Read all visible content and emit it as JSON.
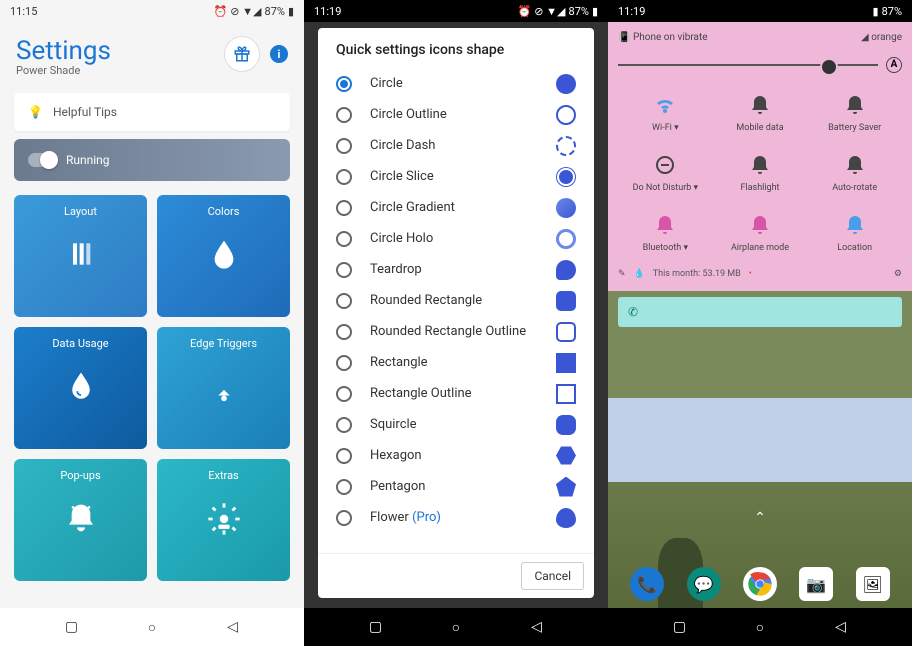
{
  "status": {
    "time1": "11:15",
    "time2": "11:19",
    "time3": "11:19",
    "battery": "87%",
    "icons": "⏰ ⊘ ▼◢"
  },
  "s1": {
    "title": "Settings",
    "subtitle": "Power Shade",
    "tips": "Helpful Tips",
    "running": "Running",
    "tiles": [
      {
        "label": "Layout",
        "icon": "layout"
      },
      {
        "label": "Colors",
        "icon": "colors"
      },
      {
        "label": "Data Usage",
        "icon": "data"
      },
      {
        "label": "Edge Triggers",
        "icon": "edge"
      },
      {
        "label": "Pop-ups",
        "icon": "popups"
      },
      {
        "label": "Extras",
        "icon": "extras"
      }
    ]
  },
  "s2": {
    "title": "Quick settings icons shape",
    "cancel": "Cancel",
    "options": [
      {
        "label": "Circle",
        "selected": true,
        "shape": "circle"
      },
      {
        "label": "Circle Outline",
        "selected": false,
        "shape": "co"
      },
      {
        "label": "Circle Dash",
        "selected": false,
        "shape": "cd"
      },
      {
        "label": "Circle Slice",
        "selected": false,
        "shape": "cs"
      },
      {
        "label": "Circle Gradient",
        "selected": false,
        "shape": "cg"
      },
      {
        "label": "Circle Holo",
        "selected": false,
        "shape": "ch"
      },
      {
        "label": "Teardrop",
        "selected": false,
        "shape": "td"
      },
      {
        "label": "Rounded Rectangle",
        "selected": false,
        "shape": "rr"
      },
      {
        "label": "Rounded Rectangle Outline",
        "selected": false,
        "shape": "rro"
      },
      {
        "label": "Rectangle",
        "selected": false,
        "shape": "r"
      },
      {
        "label": "Rectangle Outline",
        "selected": false,
        "shape": "ro"
      },
      {
        "label": "Squircle",
        "selected": false,
        "shape": "sq"
      },
      {
        "label": "Hexagon",
        "selected": false,
        "shape": "hex"
      },
      {
        "label": "Pentagon",
        "selected": false,
        "shape": "pent"
      },
      {
        "label": "Flower",
        "pro": "(Pro)",
        "selected": false,
        "shape": "fl"
      }
    ]
  },
  "s3": {
    "vibrate": "Phone on vibrate",
    "carrier": "orange",
    "auto": "A",
    "tiles": [
      {
        "label": "Wi-Fi ▾",
        "shape": "wifi",
        "cls": "active"
      },
      {
        "label": "Mobile data",
        "shape": "bell",
        "cls": ""
      },
      {
        "label": "Battery Saver",
        "shape": "bell",
        "cls": ""
      },
      {
        "label": "Do Not Disturb ▾",
        "shape": "dnd",
        "cls": ""
      },
      {
        "label": "Flashlight",
        "shape": "bell",
        "cls": ""
      },
      {
        "label": "Auto-rotate",
        "shape": "bell",
        "cls": ""
      },
      {
        "label": "Bluetooth ▾",
        "shape": "bell",
        "cls": "magenta"
      },
      {
        "label": "Airplane mode",
        "shape": "bell",
        "cls": "magenta"
      },
      {
        "label": "Location",
        "shape": "bell",
        "cls": "active"
      }
    ],
    "data_usage": "This month: 53.19 MB",
    "dock": [
      "phone",
      "messages",
      "chrome",
      "camera",
      "photos"
    ]
  }
}
